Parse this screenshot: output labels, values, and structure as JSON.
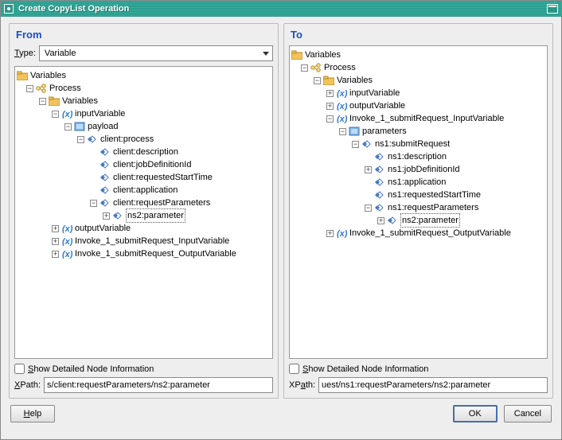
{
  "title": "Create CopyList Operation",
  "from": {
    "heading": "From",
    "type_label": "Type:",
    "type_value": "Variable",
    "tree": {
      "root": "Variables",
      "process": "Process",
      "variables": "Variables",
      "inputVariable": "inputVariable",
      "payload": "payload",
      "clientProcess": "client:process",
      "clientDescription": "client:description",
      "clientJobDefinitionId": "client:jobDefinitionId",
      "clientRequestedStartTime": "client:requestedStartTime",
      "clientApplication": "client:application",
      "clientRequestParameters": "client:requestParameters",
      "ns2parameter": "ns2:parameter",
      "outputVariable": "outputVariable",
      "invokeInput": "Invoke_1_submitRequest_InputVariable",
      "invokeOutput": "Invoke_1_submitRequest_OutputVariable"
    },
    "show_detail_label": "Show Detailed Node Information",
    "xpath_label": "XPath:",
    "xpath_value": "s/client:requestParameters/ns2:parameter"
  },
  "to": {
    "heading": "To",
    "tree": {
      "root": "Variables",
      "process": "Process",
      "variables": "Variables",
      "inputVariable": "inputVariable",
      "outputVariable": "outputVariable",
      "invokeInput": "Invoke_1_submitRequest_InputVariable",
      "parameters": "parameters",
      "ns1submitRequest": "ns1:submitRequest",
      "ns1description": "ns1:description",
      "ns1jobDefinitionId": "ns1:jobDefinitionId",
      "ns1application": "ns1:application",
      "ns1requestedStartTime": "ns1:requestedStartTime",
      "ns1requestParameters": "ns1:requestParameters",
      "ns2parameter": "ns2:parameter",
      "invokeOutput": "Invoke_1_submitRequest_OutputVariable"
    },
    "show_detail_label": "Show Detailed Node Information",
    "xpath_label": "XPath:",
    "xpath_value": "uest/ns1:requestParameters/ns2:parameter"
  },
  "buttons": {
    "help": "Help",
    "ok": "OK",
    "cancel": "Cancel"
  }
}
